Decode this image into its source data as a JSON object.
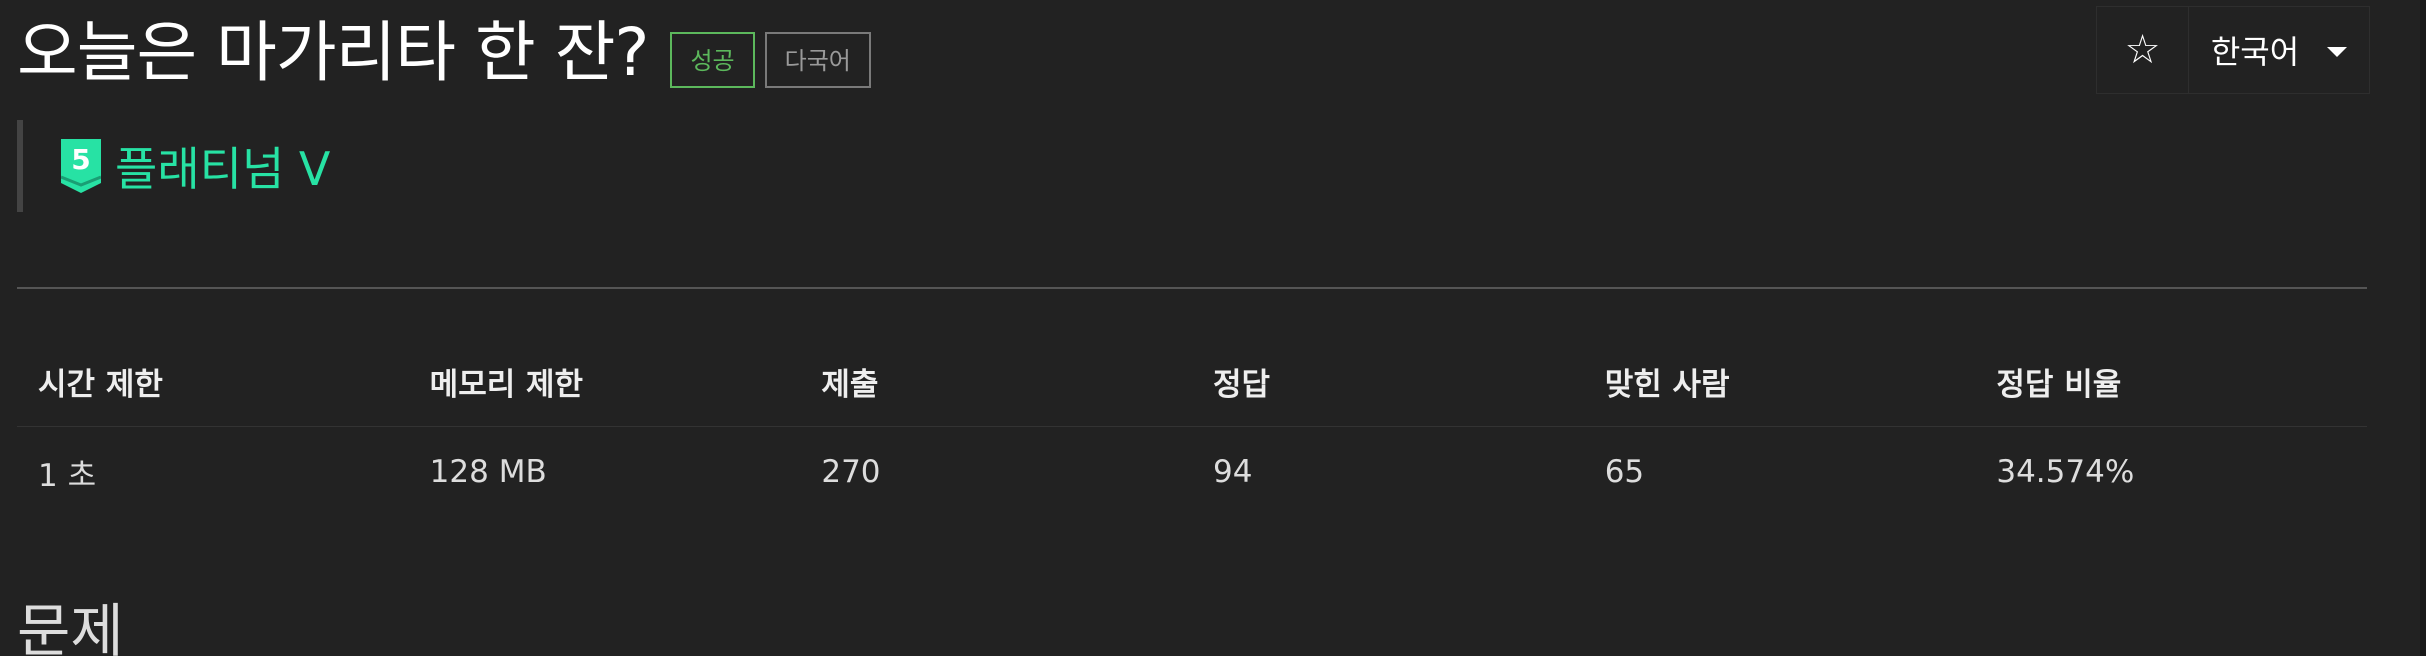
{
  "problem": {
    "title": "오늘은 마가리타 한 잔?",
    "badges": {
      "success": "성공",
      "multilang": "다국어"
    },
    "tier": {
      "level": "5",
      "name": "플래티넘 V",
      "color": "#27e2a4"
    }
  },
  "actions": {
    "star_icon": "☆",
    "language": "한국어"
  },
  "info_table": {
    "headers": [
      "시간 제한",
      "메모리 제한",
      "제출",
      "정답",
      "맞힌 사람",
      "정답 비율"
    ],
    "values": [
      "1 초",
      "128 MB",
      "270",
      "94",
      "65",
      "34.574%"
    ]
  },
  "section": {
    "heading": "문제"
  },
  "colors": {
    "background": "#222222",
    "success": "#5cb85c",
    "tier": "#27e2a4"
  }
}
